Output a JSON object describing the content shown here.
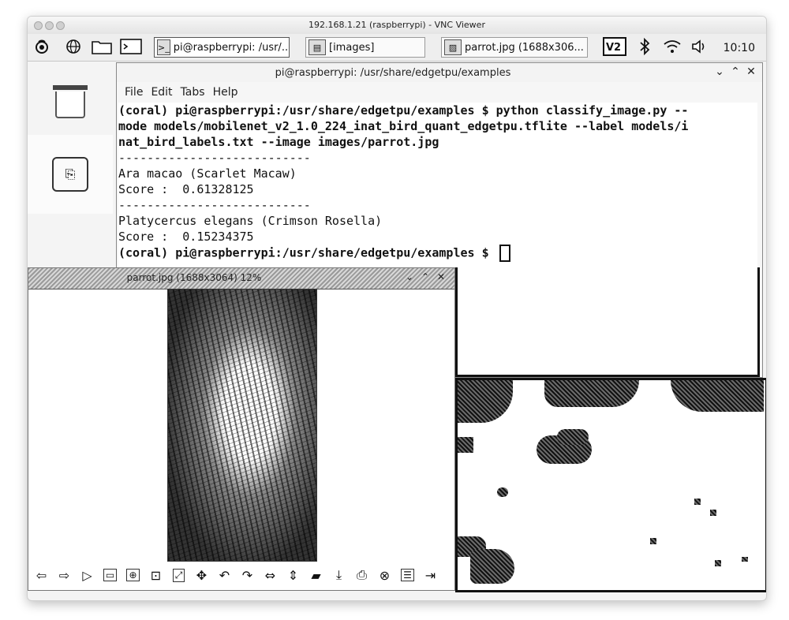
{
  "vnc": {
    "title": "192.168.1.21 (raspberrypi) - VNC Viewer"
  },
  "taskbar": {
    "items": [
      {
        "label": "pi@raspberrypi: /usr/..."
      },
      {
        "label": "[images]"
      },
      {
        "label": "parrot.jpg (1688x306..."
      }
    ],
    "clock": "10:10",
    "icons": [
      "raspberry-menu-icon",
      "globe-icon",
      "folder-icon",
      "terminal-icon",
      "vnc-icon",
      "bluetooth-icon",
      "wifi-icon",
      "volume-icon"
    ]
  },
  "desktop": {
    "icons": [
      "trash-icon",
      "usb-drive-icon"
    ]
  },
  "terminal": {
    "title": "pi@raspberrypi: /usr/share/edgetpu/examples",
    "menu": [
      "File",
      "Edit",
      "Tabs",
      "Help"
    ],
    "lines": [
      "(coral) pi@raspberrypi:/usr/share/edgetpu/examples $ python classify_image.py --",
      "mode models/mobilenet_v2_1.0_224_inat_bird_quant_edgetpu.tflite --label models/i",
      "nat_bird_labels.txt --image images/parrot.jpg",
      "---------------------------",
      "Ara macao (Scarlet Macaw)",
      "Score :  0.61328125",
      "---------------------------",
      "Platycercus elegans (Crimson Rosella)",
      "Score :  0.15234375"
    ],
    "prompt": "(coral) pi@raspberrypi:/usr/share/edgetpu/examples $ "
  },
  "viewer": {
    "title": "parrot.jpg (1688x3064) 12%",
    "toolbar_icons": [
      "back-arrow-icon",
      "forward-arrow-icon",
      "play-icon",
      "fit-window-icon",
      "zoom-fit-icon",
      "original-size-icon",
      "full-screen-icon",
      "move-icon",
      "rotate-left-icon",
      "rotate-right-icon",
      "flip-horizontal-icon",
      "flip-vertical-icon",
      "open-file-icon",
      "save-icon",
      "save-as-icon",
      "delete-icon",
      "preferences-icon",
      "exit-icon"
    ]
  }
}
